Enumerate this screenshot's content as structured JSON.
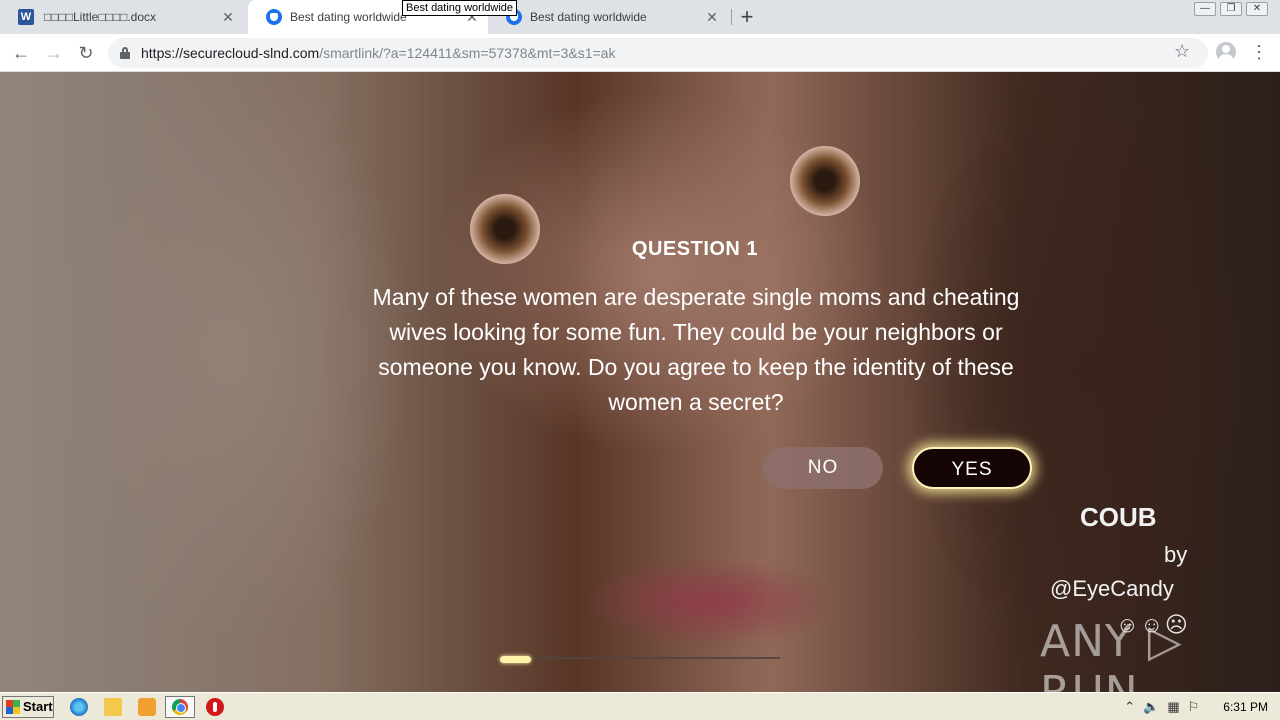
{
  "browser": {
    "tabs": [
      {
        "label": "□□□□Little□□□□.docx",
        "icon": "word-icon",
        "active": false
      },
      {
        "label": "Best dating worldwide",
        "icon": "shield-icon",
        "active": true
      },
      {
        "label": "Best dating worldwide",
        "icon": "shield-icon",
        "active": false
      }
    ],
    "tooltip": "Best dating worldwide",
    "close_glyph": "✕",
    "new_tab_glyph": "+",
    "url_host": "https://securecloud-slnd.com",
    "url_path": "/smartlink/?a=124411&sm=57378&mt=3&s1=ak",
    "window_controls": [
      "—",
      "❐",
      "✕"
    ]
  },
  "quiz": {
    "title": "QUESTION 1",
    "text": "Many of these women are desperate single moms and cheating wives looking for some fun. They could be your neighbors or someone you know. Do you agree to keep the identity of these women a secret?",
    "no_label": "NO",
    "yes_label": "YES",
    "progress": 0.11
  },
  "overlay": {
    "coub": "COUB",
    "by": "by",
    "user": "@EyeCandy",
    "emojis": "☺☺☹",
    "watermark": "ANY ▷ RUN"
  },
  "taskbar": {
    "start_label": "Start",
    "clock": "6:31 PM"
  },
  "colors": {
    "yes_button": "#150505",
    "yes_glow": "#fff3c2",
    "no_button": "#8c6e69",
    "progress": "#fff3a6"
  }
}
